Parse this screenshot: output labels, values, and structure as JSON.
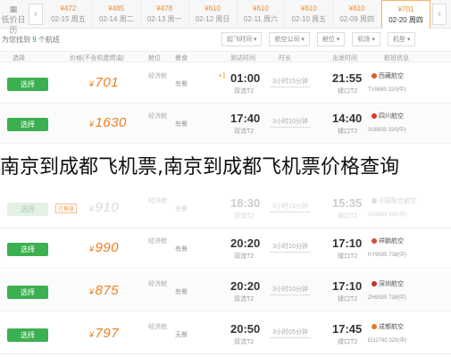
{
  "datebar": {
    "calendar_label": "低价日历",
    "left_arrow": "‹",
    "right_arrow": "›",
    "tabs": [
      {
        "price": "¥472",
        "day": "02-15 周五"
      },
      {
        "price": "¥485",
        "day": "02-14 周二"
      },
      {
        "price": "¥478",
        "day": "02-13 周一"
      },
      {
        "price": "¥610",
        "day": "02-12 周日"
      },
      {
        "price": "¥610",
        "day": "02-11 周六"
      },
      {
        "price": "¥610",
        "day": "02-10 周五"
      },
      {
        "price": "¥610",
        "day": "02-09 周四"
      },
      {
        "price": "¥701",
        "day": "02-20 周四",
        "active": true
      }
    ]
  },
  "filterbar": {
    "crumb_prefix": "为您找到",
    "crumb_count": "9",
    "crumb_suffix": "个航班",
    "filters": [
      "起飞时间 ▾",
      "航空公司 ▾",
      "舱位 ▾",
      "机场 ▾",
      "机型 ▾"
    ]
  },
  "table_header": {
    "col_select": "选择",
    "col_price": "价格(不含机建燃油)",
    "col_cabin": "舱位",
    "col_meal": "餐食",
    "col_arrival": "到达时间",
    "col_duration": "时长",
    "col_departure": "出发时间",
    "col_airline": "航班信息"
  },
  "rows": [
    {
      "select": "选择",
      "price": "701",
      "cabin": "经济舱",
      "meal": "有餐",
      "arr_time": "01:00",
      "arr_term": "双流T2",
      "duration": "3小时15分钟",
      "dep_time": "21:55",
      "dep_term": "禄口T2",
      "airline": "西藏航空",
      "flightno": "TV9880 320(中)",
      "dot_color": "#e05a2b",
      "faded": false
    },
    {
      "select": "选择",
      "price": "1630",
      "cabin": "经济舱",
      "meal": "有餐",
      "arr_time": "17:40",
      "arr_term": "双流T2",
      "duration": "3小时10分钟",
      "dep_time": "14:40",
      "dep_term": "禄口T2",
      "airline": "四川航空",
      "flightno": "3U8930 320(中)",
      "dot_color": "#d83a2a",
      "faded": false
    },
    {
      "select": "选择",
      "price": "910",
      "cabin": "经济舱",
      "meal": "有餐",
      "arr_time": "18:30",
      "arr_term": "双流T2",
      "duration": "3小时15分钟",
      "dep_time": "15:35",
      "dep_term": "禄口T2",
      "airline": "中国联合航空",
      "flightno": "CA5906 320(中)",
      "dot_color": "#dddddd",
      "faded": true,
      "badge": "已售罄"
    },
    {
      "select": "选择",
      "price": "990",
      "cabin": "经济舱",
      "meal": "有餐",
      "arr_time": "20:20",
      "arr_term": "双流T2",
      "duration": "3小时10分钟",
      "dep_time": "17:10",
      "dep_term": "禄口T2",
      "airline": "祥鹏航空",
      "flightno": "KY9595 738(中)",
      "dot_color": "#d94a3a",
      "faded": false
    },
    {
      "select": "选择",
      "price": "875",
      "cabin": "经济舱",
      "meal": "有餐",
      "arr_time": "20:20",
      "arr_term": "双流T2",
      "duration": "3小时10分钟",
      "dep_time": "17:10",
      "dep_term": "禄口T2",
      "airline": "深圳航空",
      "flightno": "ZH9595 738(中)",
      "dot_color": "#c8322a",
      "faded": false
    },
    {
      "select": "选择",
      "price": "797",
      "cabin": "经济舱",
      "meal": "无餐",
      "arr_time": "20:50",
      "arr_term": "双流T2",
      "duration": "3小时05分钟",
      "dep_time": "17:45",
      "dep_term": "禄口T2",
      "airline": "成都航空",
      "flightno": "EU2760 320(中)",
      "dot_color": "#e07a2a",
      "faded": false
    }
  ],
  "caption": "南京到成都飞机票,南京到成都飞机票价格查询"
}
